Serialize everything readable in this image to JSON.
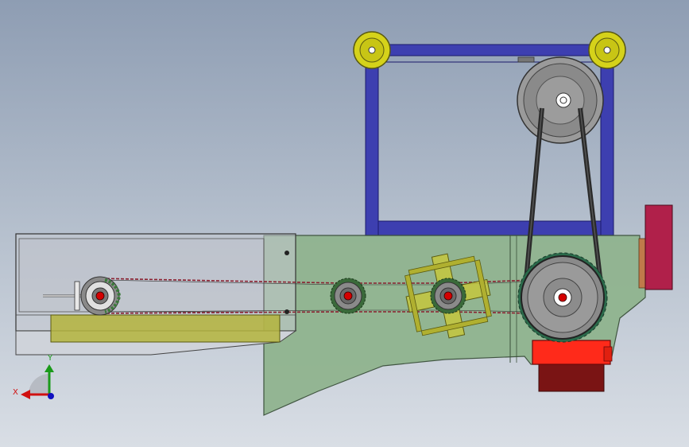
{
  "triad": {
    "x_label": "X",
    "y_label": "Y"
  },
  "colors": {
    "frame": "#3d3fb0",
    "housing": "#90b48f",
    "pulley": "#8a8a8a",
    "idler": "#d5d21a",
    "belt": "#2a2a2a",
    "motor": "#ff2a1a",
    "motor_base": "#7a1414",
    "side_block": "#b0204a",
    "conveyor_box": "#b9bec8",
    "tray": "#b4b43c",
    "shaft_core": "#d40000",
    "chain": "#8a2030"
  },
  "icons": {
    "triad": "view-orientation-triad-icon"
  }
}
